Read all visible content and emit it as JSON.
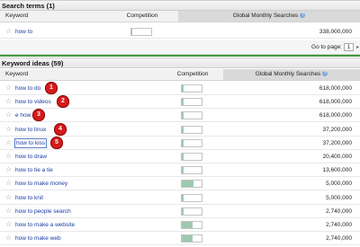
{
  "search_terms": {
    "title": "Search terms (1)",
    "columns": {
      "keyword": "Keyword",
      "competition": "Competition",
      "gms": "Global Monthly Searches"
    },
    "rows": [
      {
        "keyword": "how to",
        "competition": 0.05,
        "searches": "338,000,000"
      }
    ],
    "pager": {
      "label": "Go to page:",
      "page": "1"
    }
  },
  "keyword_ideas": {
    "title": "Keyword ideas (59)",
    "columns": {
      "keyword": "Keyword",
      "competition": "Competition",
      "gms": "Global Monthly Searches"
    },
    "rows": [
      {
        "keyword": "how to do",
        "competition": 0.08,
        "searches": "618,000,000",
        "badge": "1"
      },
      {
        "keyword": "how to videos",
        "competition": 0.08,
        "searches": "618,000,000",
        "badge": "2"
      },
      {
        "keyword": "e how",
        "competition": 0.08,
        "searches": "618,000,000",
        "badge": "3"
      },
      {
        "keyword": "how to linux",
        "competition": 0.08,
        "searches": "37,200,000",
        "badge": "4"
      },
      {
        "keyword": "how to kiss",
        "competition": 0.08,
        "searches": "37,200,000",
        "badge": "5"
      },
      {
        "keyword": "how to draw",
        "competition": 0.08,
        "searches": "20,400,000"
      },
      {
        "keyword": "how to tie a tie",
        "competition": 0.08,
        "searches": "13,600,000"
      },
      {
        "keyword": "how to make money",
        "competition": 0.6,
        "searches": "5,000,000"
      },
      {
        "keyword": "how to knit",
        "competition": 0.08,
        "searches": "5,000,000"
      },
      {
        "keyword": "how to people search",
        "competition": 0.08,
        "searches": "2,740,000"
      },
      {
        "keyword": "how to make a website",
        "competition": 0.55,
        "searches": "2,740,000"
      },
      {
        "keyword": "how to make web",
        "competition": 0.55,
        "searches": "2,740,000"
      }
    ]
  },
  "colors": {
    "link": "#1a3da0",
    "badge": "#d61a1a",
    "competition_fill": "#9ec9b0",
    "divider": "#3f9a3f"
  },
  "icons": {
    "star": "star-icon",
    "info": "info-icon",
    "badge": "heart-badge-icon"
  }
}
